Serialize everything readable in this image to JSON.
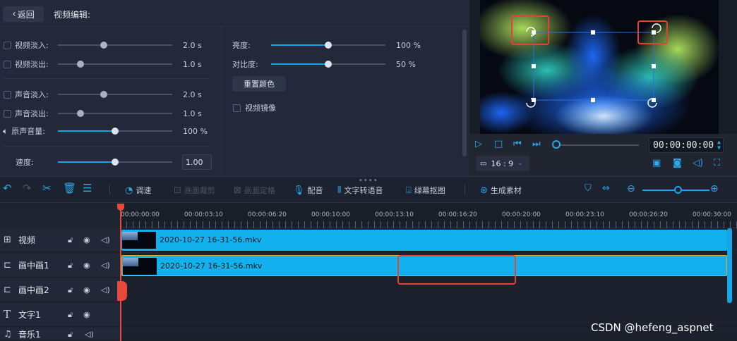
{
  "edit_panel": {
    "back_label": "返回",
    "title": "视频编辑:",
    "video_fade_in": {
      "label": "视频淡入:",
      "value": "2.0 s",
      "fraction": 0.4
    },
    "video_fade_out": {
      "label": "视频淡出:",
      "value": "1.0 s",
      "fraction": 0.2
    },
    "audio_fade_in": {
      "label": "声音淡入:",
      "value": "2.0 s",
      "fraction": 0.4
    },
    "audio_fade_out": {
      "label": "声音淡出:",
      "value": "1.0 s",
      "fraction": 0.2
    },
    "original_volume": {
      "label": "原声音量:",
      "value": "100 %",
      "fraction": 0.5
    },
    "speed": {
      "label": "速度:",
      "value": "1.00",
      "fraction": 0.5
    },
    "brightness": {
      "label": "亮度:",
      "value": "100 %",
      "fraction": 0.5
    },
    "contrast": {
      "label": "对比度:",
      "value": "50 %",
      "fraction": 0.5
    },
    "reset_color_label": "重置颜色",
    "mirror_label": "视频镜像"
  },
  "preview": {
    "timecode": "00:00:00:00",
    "aspect_ratio": "16 : 9",
    "playback_fraction": 0
  },
  "toolbar": {
    "speed": "调速",
    "crop": "画面裁剪",
    "position": "画面定格",
    "dub": "配音",
    "tts": "文字转语音",
    "green_screen": "绿幕抠图",
    "generate": "生成素材",
    "zoom_fraction": 0.53
  },
  "timeline": {
    "ruler": [
      "00:00:00:00",
      "00:00:03:10",
      "00:00:06:20",
      "00:00:10:00",
      "00:00:13:10",
      "00:00:16:20",
      "00:00:20:00",
      "00:00:23:10",
      "00:00:26:20",
      "00:00:30:00"
    ],
    "tracks": [
      {
        "name": "视频",
        "icon": "film-icon",
        "clip": "2020-10-27 16-31-56.mkv"
      },
      {
        "name": "画中画1",
        "icon": "pip-icon",
        "clip": "2020-10-27 16-31-56.mkv"
      },
      {
        "name": "画中画2",
        "icon": "pip-icon",
        "clip": ""
      },
      {
        "name": "文字1",
        "icon": "text-icon",
        "clip": ""
      },
      {
        "name": "音乐1",
        "icon": "music-icon",
        "clip": ""
      }
    ]
  },
  "watermark": "CSDN @hefeng_aspnet",
  "colors": {
    "accent": "#13a6e8",
    "clip": "#13b0ee",
    "highlight": "#e0452f"
  }
}
